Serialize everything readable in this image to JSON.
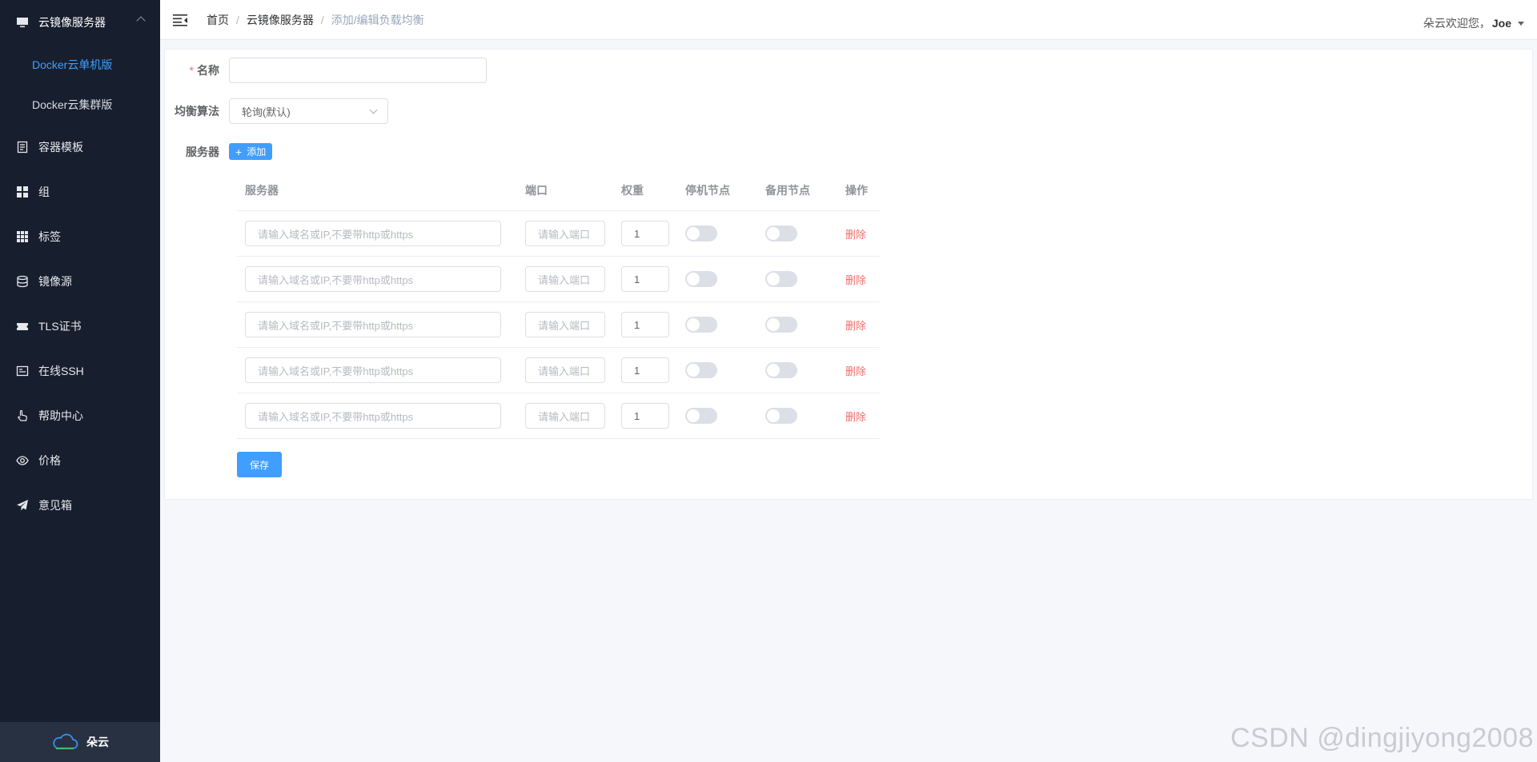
{
  "sidebar": {
    "group": {
      "label": "云镜像服务器",
      "icon": "monitor-icon"
    },
    "subitems": [
      {
        "label": "Docker云单机版",
        "active": true
      },
      {
        "label": "Docker云集群版",
        "active": false
      }
    ],
    "items": [
      {
        "label": "容器模板",
        "icon": "document-icon"
      },
      {
        "label": "组",
        "icon": "grid-icon"
      },
      {
        "label": "标签",
        "icon": "table-icon"
      },
      {
        "label": "镜像源",
        "icon": "database-icon"
      },
      {
        "label": "TLS证书",
        "icon": "ticket-icon"
      },
      {
        "label": "在线SSH",
        "icon": "terminal-card-icon"
      },
      {
        "label": "帮助中心",
        "icon": "pointer-hand-icon"
      },
      {
        "label": "价格",
        "icon": "eye-icon"
      },
      {
        "label": "意见箱",
        "icon": "paper-plane-icon"
      }
    ],
    "footer": {
      "label": "朵云",
      "icon": "cloud-logo-icon"
    }
  },
  "header": {
    "breadcrumb": [
      "首页",
      "云镜像服务器",
      "添加/编辑负载均衡"
    ],
    "separator": "/",
    "welcome": "朵云欢迎您，",
    "user": "Joe"
  },
  "form": {
    "name_label": "名称",
    "name_required_mark": "*",
    "name_value": "",
    "algo_label": "均衡算法",
    "algo_value": "轮询(默认)",
    "servers_label": "服务器",
    "add_button": "添加",
    "add_icon": "+",
    "save_button": "保存"
  },
  "table": {
    "columns": [
      "服务器",
      "端口",
      "权重",
      "停机节点",
      "备用节点",
      "操作"
    ],
    "rows": [
      {
        "server_placeholder": "请输入域名或IP,不要带http或https",
        "port_placeholder": "请输入端口",
        "weight": "1",
        "down": false,
        "backup": false,
        "action": "删除"
      },
      {
        "server_placeholder": "请输入域名或IP,不要带http或https",
        "port_placeholder": "请输入端口",
        "weight": "1",
        "down": false,
        "backup": false,
        "action": "删除"
      },
      {
        "server_placeholder": "请输入域名或IP,不要带http或https",
        "port_placeholder": "请输入端口",
        "weight": "1",
        "down": false,
        "backup": false,
        "action": "删除"
      },
      {
        "server_placeholder": "请输入域名或IP,不要带http或https",
        "port_placeholder": "请输入端口",
        "weight": "1",
        "down": false,
        "backup": false,
        "action": "删除"
      },
      {
        "server_placeholder": "请输入域名或IP,不要带http或https",
        "port_placeholder": "请输入端口",
        "weight": "1",
        "down": false,
        "backup": false,
        "action": "删除"
      }
    ]
  },
  "watermark": "CSDN @dingjiyong2008",
  "colors": {
    "sidebar_bg": "#171f2e",
    "accent": "#409eff",
    "danger": "#f56c6c"
  }
}
